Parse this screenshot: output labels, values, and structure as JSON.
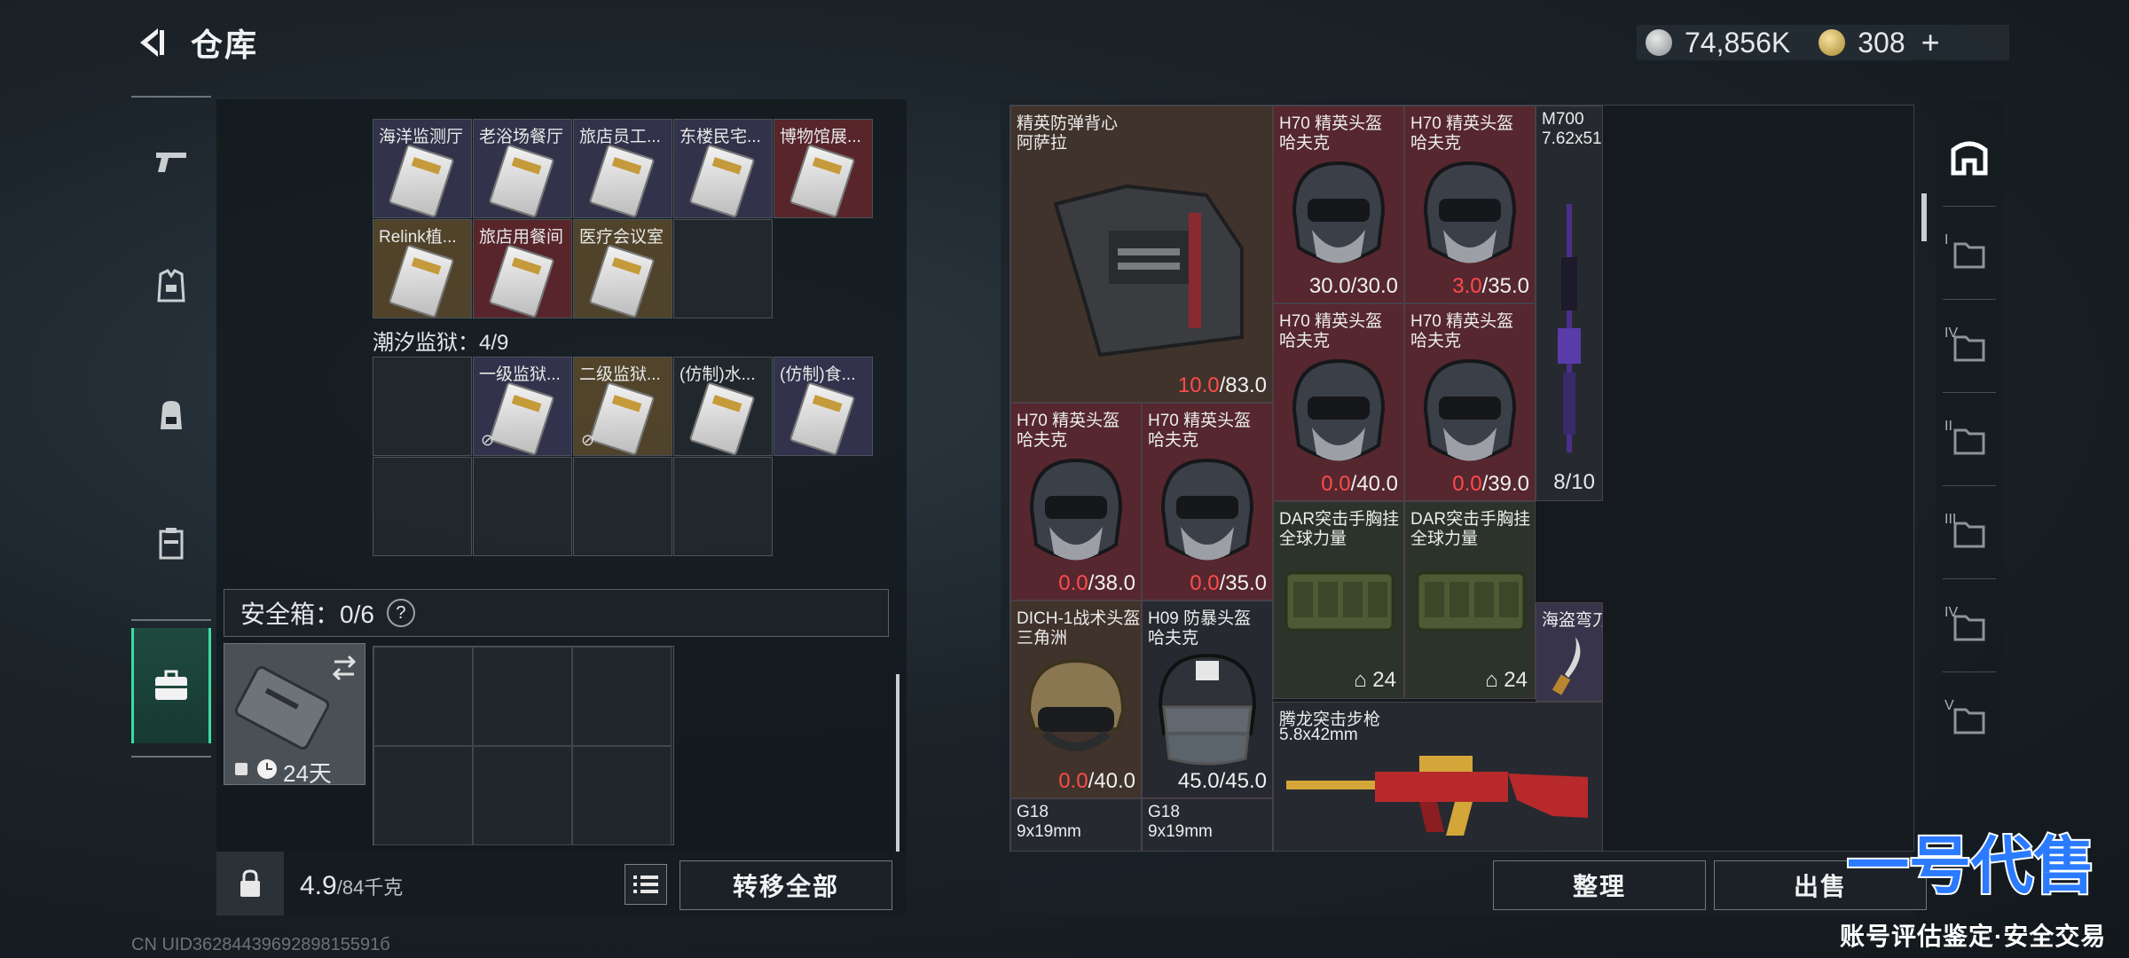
{
  "header": {
    "title": "仓库",
    "silver_amount": "74,856K",
    "gold_amount": "308",
    "plus": "+"
  },
  "left_panel": {
    "top_rows": [
      [
        {
          "label": "海洋监测厅",
          "tint": "purple"
        },
        {
          "label": "老浴场餐厅",
          "tint": "purple"
        },
        {
          "label": "旅店员工...",
          "tint": "purple"
        },
        {
          "label": "东楼民宅...",
          "tint": "purple"
        },
        {
          "label": "博物馆展...",
          "tint": "red"
        }
      ],
      [
        {
          "label": "Relink植...",
          "tint": "gold"
        },
        {
          "label": "旅店用餐间",
          "tint": "red"
        },
        {
          "label": "医疗会议室",
          "tint": "gold"
        }
      ]
    ],
    "section2_label": "潮汐监狱：4/9",
    "section2_items": [
      {
        "label": "一级监狱...",
        "tint": "purple"
      },
      {
        "label": "二级监狱...",
        "tint": "gold"
      },
      {
        "label": "(仿制)水...",
        "tint": "dark"
      },
      {
        "label": "(仿制)食...",
        "tint": "purple"
      }
    ],
    "safebox_label": "安全箱：0/6",
    "safebox_help": "?",
    "safebox_days": "24天",
    "weight_value": "4.9",
    "weight_capacity": "/84千克",
    "transfer_all": "转移全部"
  },
  "stash": {
    "items": [
      {
        "name": "精英防弹背心",
        "sub": "阿萨拉",
        "cur": "10.0",
        "max": "/83.0",
        "low": true
      },
      {
        "name": "H70 精英头盔",
        "sub": "哈夫克",
        "cur": "30.0",
        "max": "/30.0",
        "low": false
      },
      {
        "name": "H70 精英头盔",
        "sub": "哈夫克",
        "cur": "3.0",
        "max": "/35.0",
        "low": true
      },
      {
        "name": "M700",
        "sub": "7.62x51...",
        "stack": "8/10"
      },
      {
        "name": "H70 精英头盔",
        "sub": "哈夫克",
        "cur": "0.0",
        "max": "/40.0",
        "low": true
      },
      {
        "name": "H70 精英头盔",
        "sub": "哈夫克",
        "cur": "0.0",
        "max": "/39.0",
        "low": true
      },
      {
        "name": "H70 精英头盔",
        "sub": "哈夫克",
        "cur": "0.0",
        "max": "/38.0",
        "low": true
      },
      {
        "name": "H70 精英头盔",
        "sub": "哈夫克",
        "cur": "0.0",
        "max": "/35.0",
        "low": true
      },
      {
        "name": "DAR突击手胸挂",
        "sub": "全球力量",
        "stack": "24"
      },
      {
        "name": "DAR突击手胸挂",
        "sub": "全球力量",
        "stack": "24"
      },
      {
        "name": "海盗弯刀",
        "sub": ""
      },
      {
        "name": "DICH-1战术头盔",
        "sub": "三角洲",
        "cur": "0.0",
        "max": "/40.0",
        "low": true
      },
      {
        "name": "H09 防暴头盔",
        "sub": "哈夫克",
        "cur": "45.0",
        "max": "/45.0",
        "low": false
      },
      {
        "name": "腾龙突击步枪",
        "sub": "5.8x42mm"
      },
      {
        "name": "G18",
        "sub": "9x19mm"
      },
      {
        "name": "G18",
        "sub": "9x19mm"
      }
    ],
    "sort_label": "整理",
    "sell_label": "出售"
  },
  "right_tabs": [
    "",
    "I",
    "IV",
    "II",
    "III",
    "IV",
    "V"
  ],
  "watermark": {
    "logo": "一号代售",
    "slogan": "账号评估鉴定·安全交易"
  },
  "status": {
    "uid": "CN UID3628443969289815591б"
  },
  "colors": {
    "accent": "#3ddca0",
    "low_durability": "#ff4b4b",
    "watermark_blue": "#1e6fff"
  }
}
